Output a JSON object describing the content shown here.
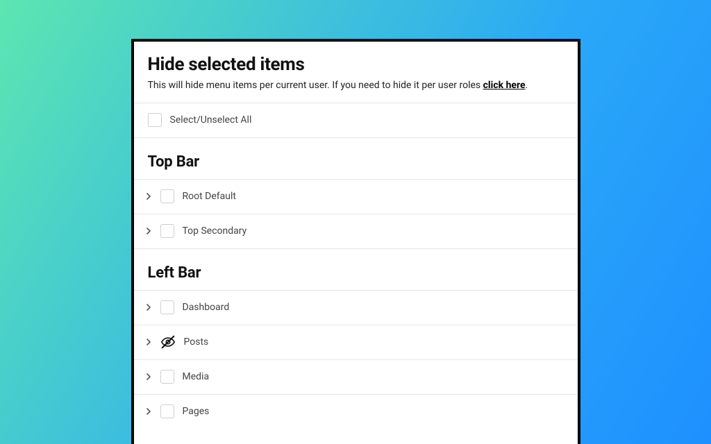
{
  "header": {
    "title": "Hide selected items",
    "subtitle_prefix": "This will hide menu items per current user. If you need to hide it per user roles ",
    "subtitle_link": "click here",
    "subtitle_suffix": "."
  },
  "select_all_label": "Select/Unselect All",
  "sections": {
    "top_bar": {
      "heading": "Top Bar",
      "items": [
        {
          "label": "Root Default",
          "hidden": false
        },
        {
          "label": "Top Secondary",
          "hidden": false
        }
      ]
    },
    "left_bar": {
      "heading": "Left Bar",
      "items": [
        {
          "label": "Dashboard",
          "hidden": false
        },
        {
          "label": "Posts",
          "hidden": true
        },
        {
          "label": "Media",
          "hidden": false
        },
        {
          "label": "Pages",
          "hidden": false
        }
      ]
    }
  }
}
